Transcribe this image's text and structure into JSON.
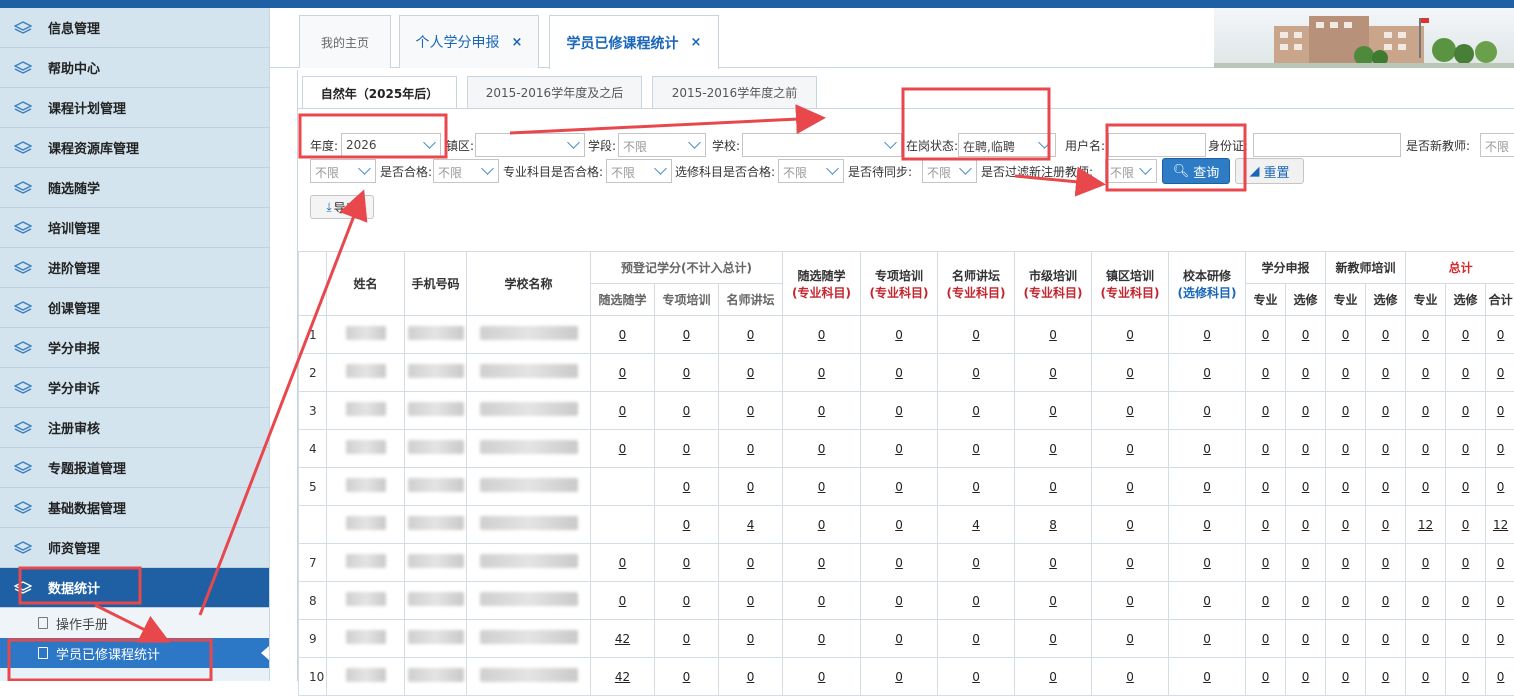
{
  "sidebar": {
    "items": [
      {
        "label": "信息管理"
      },
      {
        "label": "帮助中心"
      },
      {
        "label": "课程计划管理"
      },
      {
        "label": "课程资源库管理"
      },
      {
        "label": "随选随学"
      },
      {
        "label": "培训管理"
      },
      {
        "label": "进阶管理"
      },
      {
        "label": "创课管理"
      },
      {
        "label": "学分申报"
      },
      {
        "label": "学分申诉"
      },
      {
        "label": "注册审核"
      },
      {
        "label": "专题报道管理"
      },
      {
        "label": "基础数据管理"
      },
      {
        "label": "师资管理"
      },
      {
        "label": "数据统计"
      }
    ],
    "subitems": [
      {
        "label": "操作手册"
      },
      {
        "label": "学员已修课程统计"
      }
    ]
  },
  "tabs": {
    "home": "我的主页",
    "credit": "个人学分申报",
    "stats": "学员已修课程统计",
    "close": "×"
  },
  "subtabs": [
    "自然年（2025年后）",
    "2015-2016学年度及之后",
    "2015-2016学年度之前"
  ],
  "filters": {
    "year_label": "年度:",
    "year_value": "2026",
    "district_label": "镇区:",
    "stage_label": "学段:",
    "stage_value": "不限",
    "school_label": "学校:",
    "status_label": "在岗状态:",
    "status_value": "在聘,临聘",
    "username_label": "用户名:",
    "idcard_label": "身份证:",
    "newteacher_label": "是否新教师:",
    "newteacher_value": "不限",
    "row2_first_value": "不限",
    "qualified_label": "是否合格:",
    "qualified_value": "不限",
    "major_label": "专业科目是否合格:",
    "major_value": "不限",
    "elective_label": "选修科目是否合格:",
    "elective_value": "不限",
    "sync_label": "是否待同步:",
    "sync_value": "不限",
    "filternew_label": "是否过滤新注册教师:",
    "filternew_value": "不限",
    "query_btn": "查询",
    "reset_btn": "重置",
    "export_btn": "导出"
  },
  "table": {
    "headers": {
      "name": "姓名",
      "phone": "手机号码",
      "school": "学校名称",
      "prereg": "预登记学分(不计入总计)",
      "prereg_sub": [
        "随选随学",
        "专项培训",
        "名师讲坛"
      ],
      "suixuan": "随选随学",
      "zhuanxiang": "专项培训",
      "mingshi": "名师讲坛",
      "shiji": "市级培训",
      "zhenqu": "镇区培训",
      "xiaoben": "校本研修",
      "major_tag": "(专业科目)",
      "elective_tag": "(选修科目)",
      "xuefen": "学分申报",
      "xinjiaoshi": "新教师培训",
      "total": "总计",
      "pair": [
        "专业",
        "选修"
      ],
      "total_sub": [
        "专业",
        "选修",
        "合计"
      ]
    },
    "rows": [
      {
        "idx": "1",
        "v": [
          "0",
          "0",
          "0",
          "0",
          "0",
          "0",
          "0",
          "0",
          "0",
          "0",
          "0",
          "0",
          "0",
          "0",
          "0",
          "0"
        ]
      },
      {
        "idx": "2",
        "v": [
          "0",
          "0",
          "0",
          "0",
          "0",
          "0",
          "0",
          "0",
          "0",
          "0",
          "0",
          "0",
          "0",
          "0",
          "0",
          "0"
        ]
      },
      {
        "idx": "3",
        "v": [
          "0",
          "0",
          "0",
          "0",
          "0",
          "0",
          "0",
          "0",
          "0",
          "0",
          "0",
          "0",
          "0",
          "0",
          "0",
          "0"
        ]
      },
      {
        "idx": "4",
        "v": [
          "0",
          "0",
          "0",
          "0",
          "0",
          "0",
          "0",
          "0",
          "0",
          "0",
          "0",
          "0",
          "0",
          "0",
          "0",
          "0"
        ]
      },
      {
        "idx": "5",
        "v": [
          "",
          "0",
          "0",
          "0",
          "0",
          "0",
          "0",
          "0",
          "0",
          "0",
          "0",
          "0",
          "0",
          "0",
          "0",
          "0"
        ]
      },
      {
        "idx": "",
        "v": [
          "",
          "0",
          "4",
          "0",
          "0",
          "4",
          "8",
          "0",
          "0",
          "0",
          "0",
          "0",
          "0",
          "12",
          "0",
          "12"
        ]
      },
      {
        "idx": "7",
        "v": [
          "0",
          "0",
          "0",
          "0",
          "0",
          "0",
          "0",
          "0",
          "0",
          "0",
          "0",
          "0",
          "0",
          "0",
          "0",
          "0"
        ]
      },
      {
        "idx": "8",
        "v": [
          "0",
          "0",
          "0",
          "0",
          "0",
          "0",
          "0",
          "0",
          "0",
          "0",
          "0",
          "0",
          "0",
          "0",
          "0",
          "0"
        ]
      },
      {
        "idx": "9",
        "v": [
          "42",
          "0",
          "0",
          "0",
          "0",
          "0",
          "0",
          "0",
          "0",
          "0",
          "0",
          "0",
          "0",
          "0",
          "0",
          "0"
        ]
      },
      {
        "idx": "10",
        "v": [
          "42",
          "0",
          "0",
          "0",
          "0",
          "0",
          "0",
          "0",
          "0",
          "0",
          "0",
          "0",
          "0",
          "0",
          "0",
          "0"
        ]
      }
    ]
  },
  "colors": {
    "accent": "#1f5fa3",
    "annotation": "#e8474c"
  }
}
